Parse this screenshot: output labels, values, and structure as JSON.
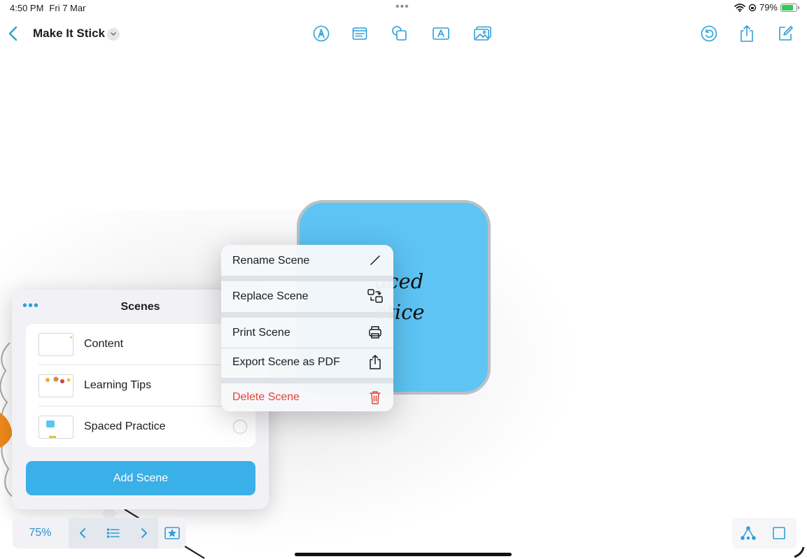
{
  "status_bar": {
    "time": "4:50 PM",
    "date": "Fri 7 Mar",
    "battery": "79%",
    "battery_level": 0.79,
    "multitask_dots": "•••"
  },
  "nav": {
    "title": "Make It Stick"
  },
  "canvas": {
    "card_text": "aced\nctice",
    "card_color": "#5ec4f4"
  },
  "scenes_panel": {
    "title": "Scenes",
    "more": "•••",
    "items": [
      {
        "label": "Content"
      },
      {
        "label": "Learning Tips"
      },
      {
        "label": "Spaced Practice"
      }
    ],
    "add_label": "Add Scene"
  },
  "context_menu": {
    "items": [
      {
        "label": "Rename Scene",
        "icon": "pencil-icon"
      },
      {
        "label": "Replace Scene",
        "icon": "replace-icon"
      },
      {
        "label": "Print Scene",
        "icon": "printer-icon"
      },
      {
        "label": "Export Scene as PDF",
        "icon": "share-icon"
      },
      {
        "label": "Delete Scene",
        "icon": "trash-icon",
        "destructive": true
      }
    ],
    "destructive_color": "#e5443a"
  },
  "bottom_bar": {
    "zoom": "75%"
  },
  "colors": {
    "accent": "#2f9fd8",
    "button": "#3ab0e8"
  }
}
